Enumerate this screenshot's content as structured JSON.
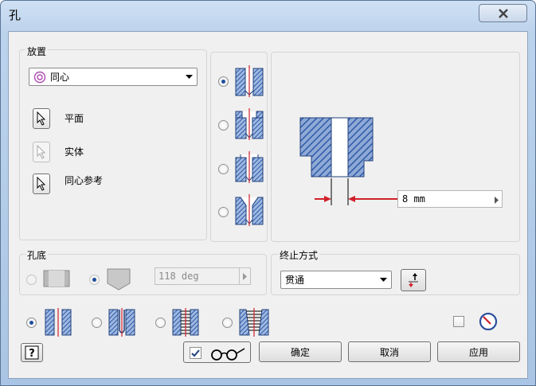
{
  "window": {
    "title": "孔"
  },
  "placement": {
    "legend": "放置",
    "type_value": "同心",
    "selectors": [
      {
        "label": "平面",
        "enabled": true
      },
      {
        "label": "实体",
        "enabled": false
      },
      {
        "label": "同心参考",
        "enabled": true
      }
    ]
  },
  "hole_types": [
    "simple-drill",
    "counterbore",
    "spotface",
    "countersink"
  ],
  "preview": {
    "dimension_value": "8 mm"
  },
  "drill_point": {
    "legend": "孔底",
    "angle_value": "118 deg"
  },
  "termination": {
    "legend": "终止方式",
    "value": "贯通"
  },
  "thread_types": [
    "simple",
    "clearance",
    "tapped",
    "taper-tapped"
  ],
  "buttons": {
    "ok": "确定",
    "cancel": "取消",
    "apply": "应用"
  },
  "colors": {
    "hatch": "#2d5aa8",
    "dimension": "#d0202a"
  }
}
